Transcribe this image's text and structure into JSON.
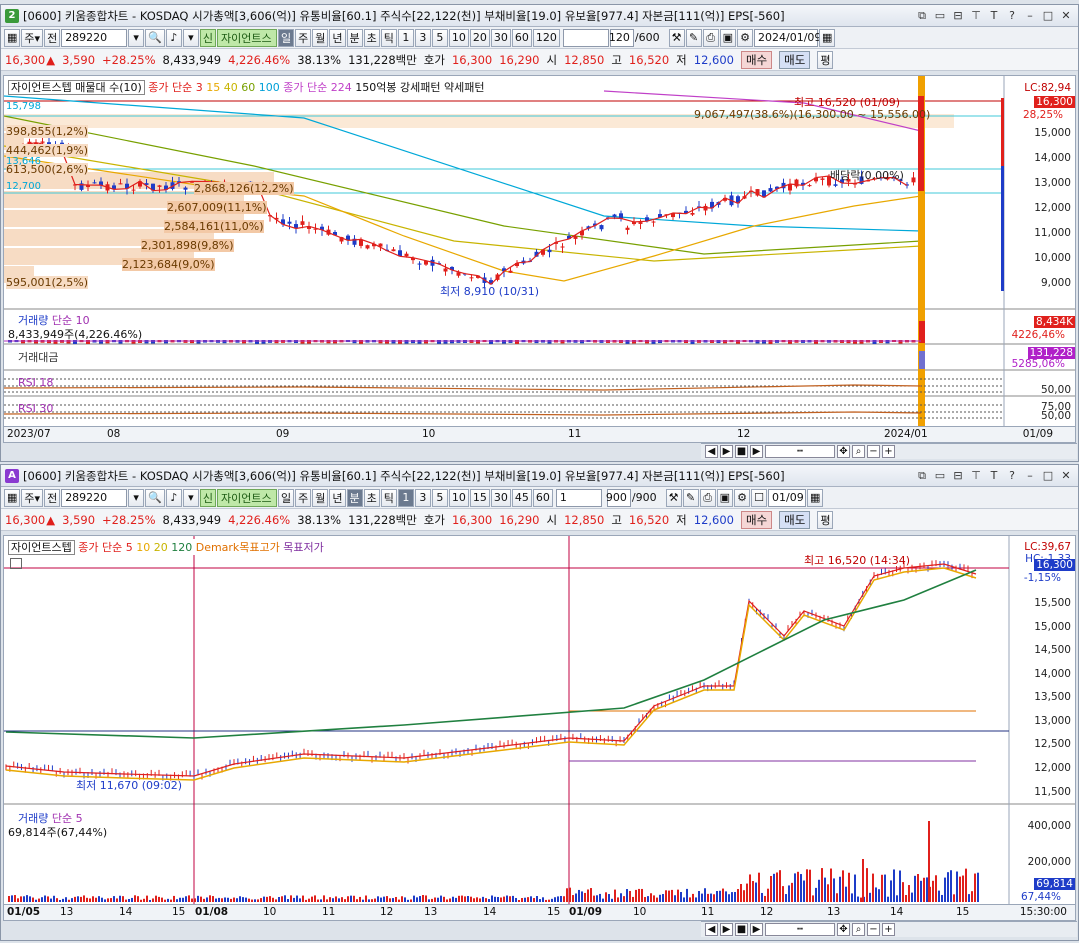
{
  "top": {
    "window_no": "2",
    "title": "[0600] 키움종합차트 - KOSDAQ 시가총액[3,606(억)] 유통비율[60.1] 주식수[22,122(천)] 부채비율[19.0] 유보율[977.4] 자본금[111(억)] EPS[-560]",
    "code": "289220",
    "stock_name": "자이언트스",
    "new_label": "신",
    "period_buttons": [
      "일",
      "주",
      "월",
      "년",
      "분",
      "초",
      "틱"
    ],
    "interval_buttons": [
      "1",
      "3",
      "5",
      "10",
      "20",
      "30",
      "60",
      "120"
    ],
    "count": "120",
    "count_max": "/600",
    "date": "2024/01/09",
    "legend": [
      "자이언트스텝 매물대 수(10)",
      "종가 단순 3",
      "15",
      "40",
      "60",
      "100",
      "종가 단순 224",
      "150억봉 강세패턴",
      "약세패턴"
    ],
    "annotations": {
      "high": "최고 16,520 (01/09)",
      "band": "9,067,497(38.6%)(16,300.00 ~ 15,556.00)",
      "ex_div": "배당락(0.00%)",
      "low": "최저 8,910 (10/31)"
    },
    "vol_profile": [
      "398,855(1,2%)",
      "444,462(1,9%)",
      "613,500(2,6%)",
      "2,868,126(12,2%)",
      "2,607,009(11,1%)",
      "2,584,161(11,0%)",
      "2,301,898(9,8%)",
      "2,123,684(9,0%)",
      "595,001(2,5%)"
    ],
    "left_levels": [
      "15,798",
      "13,646",
      "12,700"
    ],
    "y_ticks": [
      "15,000",
      "14,000",
      "13,000",
      "12,000",
      "11,000",
      "10,000",
      "9,000"
    ],
    "lc": "LC:82,94",
    "last_price_tag": "16,300",
    "pct_tag": "28,25%",
    "volume": {
      "label": "거래량",
      "ma": "단순 10",
      "value": "8,433,949주(4,226.46%)",
      "tag": "8,434K",
      "tag2": "4226,46%"
    },
    "amount": {
      "label": "거래대금",
      "tag": "131,228",
      "tag2": "5285,06%"
    },
    "rsi1": {
      "label": "RSI 18",
      "ticks": [
        "50,00"
      ]
    },
    "rsi2": {
      "label": "RSI 30",
      "ticks": [
        "75,00",
        "50,00"
      ]
    },
    "x_ticks": [
      "2023/07",
      "08",
      "09",
      "10",
      "11",
      "12",
      "2024/01"
    ],
    "x_right": "01/09"
  },
  "bottom": {
    "window_no": "A",
    "title": "[0600] 키움종합차트 - KOSDAQ 시가총액[3,606(억)] 유통비율[60.1] 주식수[22,122(천)] 부채비율[19.0] 유보율[977.4] 자본금[111(억)] EPS[-560]",
    "code": "289220",
    "stock_name": "자이언트스",
    "new_label": "신",
    "period_buttons": [
      "일",
      "주",
      "월",
      "년",
      "분",
      "초",
      "틱"
    ],
    "interval_buttons": [
      "1",
      "3",
      "5",
      "10",
      "15",
      "30",
      "45",
      "60"
    ],
    "interval_value": "1",
    "count": "900",
    "count_max": "/900",
    "date": "01/09",
    "legend": [
      "자이언트스텝",
      "종가 단순 5",
      "10",
      "20",
      "120",
      "Demark목표고가",
      "목표저가"
    ],
    "annotations": {
      "high": "최고 16,520 (14:34)",
      "low": "최저 11,670 (09:02)"
    },
    "y_ticks": [
      "15,500",
      "15,000",
      "14,500",
      "14,000",
      "13,500",
      "13,000",
      "12,500",
      "12,000",
      "11,500"
    ],
    "lc": "LC:39,67",
    "hc": "HC:-1,33",
    "last_price_tag": "16,300",
    "pct_tag": "-1,15%",
    "volume": {
      "label": "거래량",
      "ma": "단순 5",
      "value": "69,814주(67,44%)",
      "tag": "69,814",
      "tag2": "67,44%",
      "ticks": [
        "400,000",
        "200,000"
      ]
    },
    "x_ticks": [
      "01/05",
      "13",
      "14",
      "15",
      "01/08",
      "10",
      "11",
      "12",
      "13",
      "14",
      "15",
      "01/09",
      "10",
      "11",
      "12",
      "13",
      "14",
      "15"
    ],
    "x_right": "15:30:00"
  },
  "price": {
    "last": "16,300",
    "change": "3,590",
    "change_pct": "+28.25%",
    "volume": "8,433,949",
    "vol_pct": "4,226.46%",
    "turnover": "38.13%",
    "amount": "131,228백만",
    "bid_label": "호가",
    "bid1": "16,300",
    "bid2": "16,290",
    "open_label": "시",
    "open": "12,850",
    "high_label": "고",
    "high": "16,520",
    "low_label": "저",
    "low": "12,600",
    "buy": "매수",
    "sell": "매도",
    "eval": "평"
  },
  "colors": {
    "up": "#e0201c",
    "down": "#1e3cc8",
    "ma_orange": "#f0a000"
  }
}
